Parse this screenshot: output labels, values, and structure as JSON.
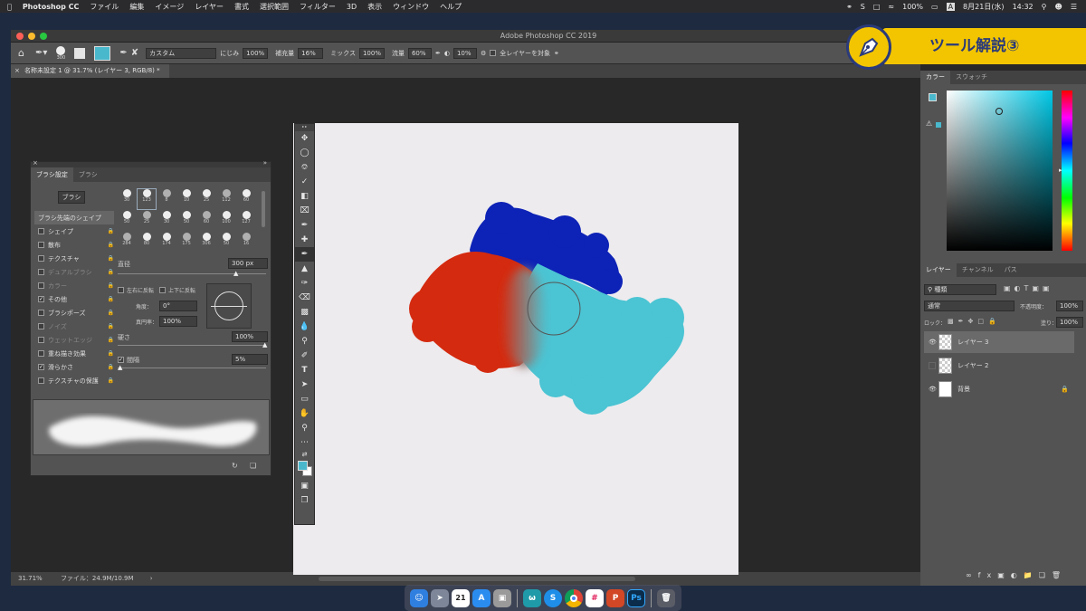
{
  "menubar": {
    "app": "Photoshop CC",
    "items": [
      "ファイル",
      "編集",
      "イメージ",
      "レイヤー",
      "書式",
      "選択範囲",
      "フィルター",
      "3D",
      "表示",
      "ウィンドウ",
      "ヘルプ"
    ],
    "battery": "100%",
    "date": "8月21日(水)",
    "time": "14:32",
    "input_method": "A"
  },
  "window": {
    "title": "Adobe Photoshop CC 2019"
  },
  "options": {
    "brush_size": "300",
    "mode": "カスタム",
    "wet_label": "にじみ",
    "wet_value": "100%",
    "load_label": "補充量",
    "load_value": "16%",
    "mix_label": "ミックス",
    "mix_value": "100%",
    "flow_label": "流量",
    "flow_value": "60%",
    "smooth_value": "10%",
    "sample_all_label": "全レイヤーを対象",
    "foreground": "#4ab8cc"
  },
  "document": {
    "tab": "名称未設定 1 @ 31.7% (レイヤー 3, RGB/8) *"
  },
  "status": {
    "zoom": "31.71%",
    "file": "ファイル：24.9M/10.9M"
  },
  "banner": {
    "text": "ツール解説③",
    "icon": "pen-nib-icon"
  },
  "brush_panel": {
    "tabs": [
      "ブラシ設定",
      "ブラシ"
    ],
    "brush_button": "ブラシ",
    "shape_header": "ブラシ先端のシェイプ",
    "options": [
      {
        "label": "シェイプ",
        "checked": false,
        "dim": false
      },
      {
        "label": "散布",
        "checked": false,
        "dim": false
      },
      {
        "label": "テクスチャ",
        "checked": false,
        "dim": false
      },
      {
        "label": "デュアルブラシ",
        "checked": false,
        "dim": true
      },
      {
        "label": "カラー",
        "checked": false,
        "dim": true
      },
      {
        "label": "その他",
        "checked": true,
        "dim": false
      },
      {
        "label": "ブラシポーズ",
        "checked": false,
        "dim": false
      },
      {
        "label": "ノイズ",
        "checked": false,
        "dim": true
      },
      {
        "label": "ウェットエッジ",
        "checked": false,
        "dim": true
      },
      {
        "label": "重ね描き効果",
        "checked": false,
        "dim": false
      },
      {
        "label": "滑らかさ",
        "checked": true,
        "dim": false
      },
      {
        "label": "テクスチャの保護",
        "checked": false,
        "dim": false
      }
    ],
    "tip_sizes": [
      "30",
      "123",
      "8",
      "10",
      "25",
      "112",
      "60",
      "50",
      "25",
      "30",
      "50",
      "60",
      "100",
      "127",
      "284",
      "80",
      "174",
      "175",
      "306",
      "50",
      "16"
    ],
    "size_label": "直径",
    "size_value": "300 px",
    "flip_x": "左右に反転",
    "flip_y": "上下に反転",
    "angle_label": "角度：",
    "angle_value": "0°",
    "roundness_label": "真円率：",
    "roundness_value": "100%",
    "hardness_label": "硬さ",
    "hardness_value": "100%",
    "spacing_label": "間隔",
    "spacing_value": "5%"
  },
  "color_panel": {
    "tabs": [
      "カラー",
      "スウォッチ"
    ]
  },
  "layers_panel": {
    "tabs": [
      "レイヤー",
      "チャンネル",
      "パス"
    ],
    "filter": "種類",
    "blend": "通常",
    "opacity_label": "不透明度：",
    "opacity_value": "100%",
    "lock_label": "ロック：",
    "fill_label": "塗り：",
    "fill_value": "100%",
    "layers": [
      {
        "name": "レイヤー 3",
        "visible": true,
        "selected": true
      },
      {
        "name": "レイヤー 2",
        "visible": false,
        "selected": false
      },
      {
        "name": "背景",
        "visible": true,
        "selected": false
      }
    ]
  },
  "dock": {
    "apps": [
      {
        "name": "finder",
        "color": "#2f7fe0"
      },
      {
        "name": "launchpad",
        "color": "#7d8799"
      },
      {
        "name": "calendar",
        "color": "#ffffff"
      },
      {
        "name": "app-store",
        "color": "#2b8cf0"
      },
      {
        "name": "preview",
        "color": "#9a9a9a"
      },
      {
        "name": "word",
        "color": "#1f9aa8"
      },
      {
        "name": "skype",
        "color": "#1e8ee8"
      },
      {
        "name": "chrome",
        "color": "#e8e8e8"
      },
      {
        "name": "slack",
        "color": "#ffffff"
      },
      {
        "name": "powerpoint",
        "color": "#d24726"
      },
      {
        "name": "photoshop",
        "color": "#0b2c4a"
      },
      {
        "name": "trash",
        "color": "#5a5d66"
      }
    ],
    "calendar_day": "21"
  }
}
